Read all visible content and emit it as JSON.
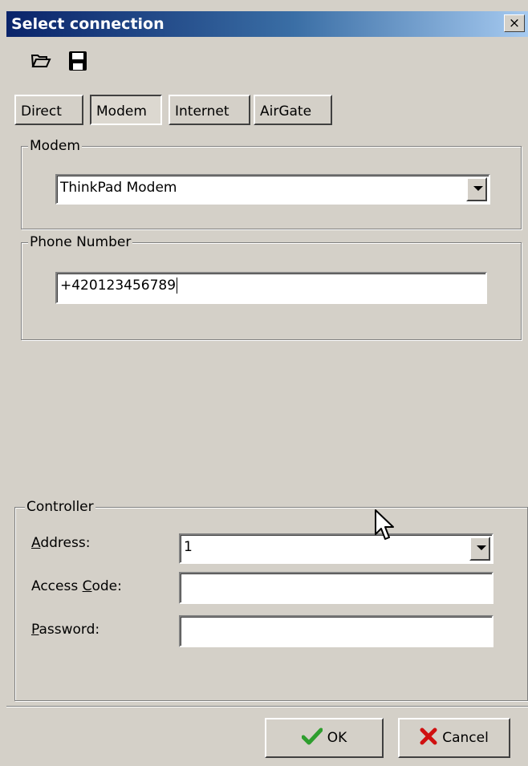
{
  "window": {
    "title": "Select connection",
    "close_label": "×"
  },
  "toolbar": {
    "open_icon": "folder-open-icon",
    "save_icon": "floppy-save-icon"
  },
  "tabs": [
    {
      "label": "Direct",
      "active": false
    },
    {
      "label": "Modem",
      "active": true
    },
    {
      "label": "Internet",
      "active": false
    },
    {
      "label": "AirGate",
      "active": false
    }
  ],
  "modem_group": {
    "label": "Modem",
    "selected": "ThinkPad Modem"
  },
  "phone_group": {
    "label": "Phone Number",
    "value": "+420123456789"
  },
  "controller": {
    "label": "Controller",
    "address_label_key": "A",
    "address_label_rest": "ddress:",
    "address_value": "1",
    "access_label_pre": "Access ",
    "access_label_key": "C",
    "access_label_rest": "ode:",
    "access_value": "",
    "password_label_key": "P",
    "password_label_rest": "assword:",
    "password_value": ""
  },
  "buttons": {
    "ok": "OK",
    "cancel": "Cancel"
  },
  "colors": {
    "title_start": "#0a246a",
    "title_end": "#a6caf0",
    "ok_check": "#2e9e2e",
    "cancel_x": "#d01010"
  }
}
